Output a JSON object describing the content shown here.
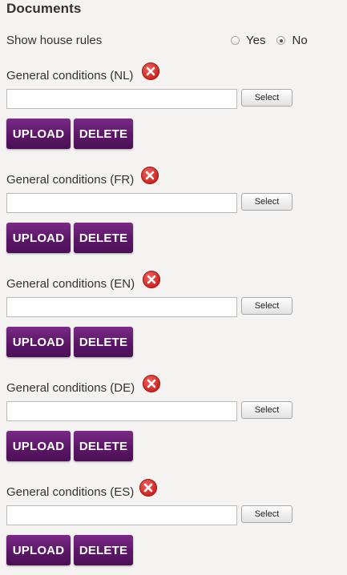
{
  "section": {
    "title": "Documents"
  },
  "house_rules": {
    "label": "Show house rules",
    "options": [
      {
        "label": "Yes",
        "checked": false
      },
      {
        "label": "No",
        "checked": true
      }
    ]
  },
  "documents": [
    {
      "label": "General conditions (NL)",
      "file_value": "",
      "select_label": "Select",
      "upload_label": "UPLOAD",
      "delete_label": "DELETE"
    },
    {
      "label": "General conditions (FR)",
      "file_value": "",
      "select_label": "Select",
      "upload_label": "UPLOAD",
      "delete_label": "DELETE"
    },
    {
      "label": "General conditions (EN)",
      "file_value": "",
      "select_label": "Select",
      "upload_label": "UPLOAD",
      "delete_label": "DELETE"
    },
    {
      "label": "General conditions (DE)",
      "file_value": "",
      "select_label": "Select",
      "upload_label": "UPLOAD",
      "delete_label": "DELETE"
    },
    {
      "label": "General conditions (ES)",
      "file_value": "",
      "select_label": "Select",
      "upload_label": "UPLOAD",
      "delete_label": "DELETE"
    }
  ],
  "icons": {
    "remove": "remove-x-icon"
  },
  "colors": {
    "page_background": "#f4f3f1",
    "primary_button": "#5b1766",
    "remove_icon": "#d9302c"
  }
}
